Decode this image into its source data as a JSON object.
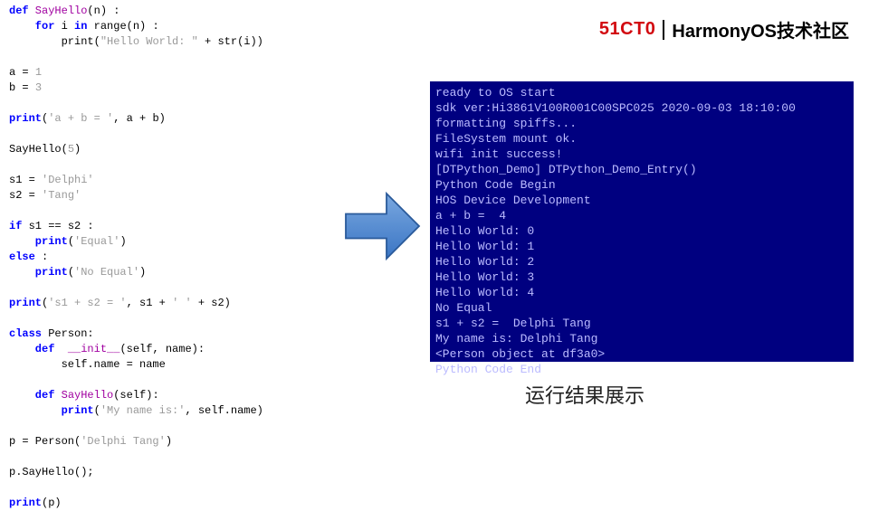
{
  "header": {
    "brand51": "51CT0",
    "harmony": "HarmonyOS技术社区"
  },
  "caption": "运行结果展示",
  "code": {
    "t01": "def",
    "t02": " SayHello",
    "t03": "(n) :",
    "t04": "    for",
    "t05": " i ",
    "t06": "in",
    "t07": " range(n) :",
    "t08": "        print(",
    "t09": "\"Hello World: \"",
    "t10": " + str(i))",
    "blank1": "",
    "t11": "a = ",
    "t11n": "1",
    "t12": "b = ",
    "t12n": "3",
    "blank2": "",
    "t13": "print",
    "t14": "(",
    "t15": "'a + b = '",
    "t16": ", a + b)",
    "blank3": "",
    "t17": "SayHello(",
    "t17n": "5",
    "t17c": ")",
    "blank4": "",
    "t18": "s1 = ",
    "t18s": "'Delphi'",
    "t19": "s2 = ",
    "t19s": "'Tang'",
    "blank5": "",
    "t20": "if",
    "t21": " s1 == s2 :",
    "t22": "    print",
    "t23": "(",
    "t24": "'Equal'",
    "t25": ")",
    "t26": "else",
    "t27": " :",
    "t28": "    print",
    "t29": "(",
    "t30": "'No Equal'",
    "t31": ")",
    "blank6": "",
    "t32": "print",
    "t33": "(",
    "t34": "'s1 + s2 = '",
    "t35": ", s1 + ",
    "t36": "' '",
    "t37": " + s2)",
    "blank7": "",
    "t38": "class",
    "t39": " Person:",
    "t40": "    def",
    "t41": "  __init__",
    "t42": "(self, name):",
    "t43": "        self.name = name",
    "blank8": "",
    "t44": "    def",
    "t45": " SayHello",
    "t46": "(self):",
    "t47": "        print",
    "t48": "(",
    "t49": "'My name is:'",
    "t50": ", self.name)",
    "blank9": "",
    "t51": "p = Person(",
    "t52": "'Delphi Tang'",
    "t53": ")",
    "blank10": "",
    "t54": "p.SayHello();",
    "blank11": "",
    "t55": "print",
    "t56": "(p)"
  },
  "term": {
    "l01": "ready to OS start",
    "l02": "sdk ver:Hi3861V100R001C00SPC025 2020-09-03 18:10:00",
    "l03": "formatting spiffs...",
    "l04": "FileSystem mount ok.",
    "l05": "wifi init success!",
    "l06": "[DTPython_Demo] DTPython_Demo_Entry()",
    "l07": "Python Code Begin",
    "l08": "HOS Device Development",
    "l09": "a + b =  4",
    "l10": "Hello World: 0",
    "l11": "Hello World: 1",
    "l12": "Hello World: 2",
    "l13": "Hello World: 3",
    "l14": "Hello World: 4",
    "l15": "No Equal",
    "l16": "s1 + s2 =  Delphi Tang",
    "l17": "My name is: Delphi Tang",
    "l18": "<Person object at df3a0>",
    "l19": "Python Code End"
  }
}
